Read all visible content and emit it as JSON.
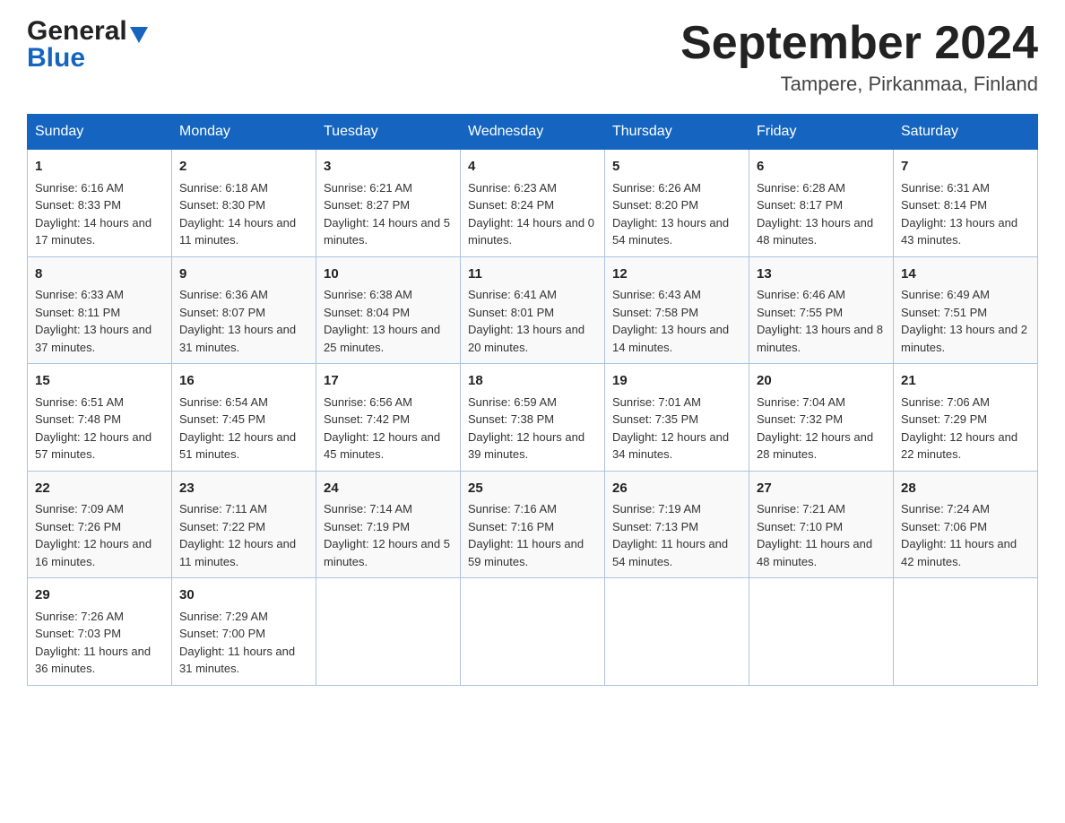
{
  "header": {
    "logo_general": "General",
    "logo_blue": "Blue",
    "month_title": "September 2024",
    "location": "Tampere, Pirkanmaa, Finland"
  },
  "weekdays": [
    "Sunday",
    "Monday",
    "Tuesday",
    "Wednesday",
    "Thursday",
    "Friday",
    "Saturday"
  ],
  "weeks": [
    [
      {
        "day": "1",
        "sunrise": "6:16 AM",
        "sunset": "8:33 PM",
        "daylight": "14 hours and 17 minutes."
      },
      {
        "day": "2",
        "sunrise": "6:18 AM",
        "sunset": "8:30 PM",
        "daylight": "14 hours and 11 minutes."
      },
      {
        "day": "3",
        "sunrise": "6:21 AM",
        "sunset": "8:27 PM",
        "daylight": "14 hours and 5 minutes."
      },
      {
        "day": "4",
        "sunrise": "6:23 AM",
        "sunset": "8:24 PM",
        "daylight": "14 hours and 0 minutes."
      },
      {
        "day": "5",
        "sunrise": "6:26 AM",
        "sunset": "8:20 PM",
        "daylight": "13 hours and 54 minutes."
      },
      {
        "day": "6",
        "sunrise": "6:28 AM",
        "sunset": "8:17 PM",
        "daylight": "13 hours and 48 minutes."
      },
      {
        "day": "7",
        "sunrise": "6:31 AM",
        "sunset": "8:14 PM",
        "daylight": "13 hours and 43 minutes."
      }
    ],
    [
      {
        "day": "8",
        "sunrise": "6:33 AM",
        "sunset": "8:11 PM",
        "daylight": "13 hours and 37 minutes."
      },
      {
        "day": "9",
        "sunrise": "6:36 AM",
        "sunset": "8:07 PM",
        "daylight": "13 hours and 31 minutes."
      },
      {
        "day": "10",
        "sunrise": "6:38 AM",
        "sunset": "8:04 PM",
        "daylight": "13 hours and 25 minutes."
      },
      {
        "day": "11",
        "sunrise": "6:41 AM",
        "sunset": "8:01 PM",
        "daylight": "13 hours and 20 minutes."
      },
      {
        "day": "12",
        "sunrise": "6:43 AM",
        "sunset": "7:58 PM",
        "daylight": "13 hours and 14 minutes."
      },
      {
        "day": "13",
        "sunrise": "6:46 AM",
        "sunset": "7:55 PM",
        "daylight": "13 hours and 8 minutes."
      },
      {
        "day": "14",
        "sunrise": "6:49 AM",
        "sunset": "7:51 PM",
        "daylight": "13 hours and 2 minutes."
      }
    ],
    [
      {
        "day": "15",
        "sunrise": "6:51 AM",
        "sunset": "7:48 PM",
        "daylight": "12 hours and 57 minutes."
      },
      {
        "day": "16",
        "sunrise": "6:54 AM",
        "sunset": "7:45 PM",
        "daylight": "12 hours and 51 minutes."
      },
      {
        "day": "17",
        "sunrise": "6:56 AM",
        "sunset": "7:42 PM",
        "daylight": "12 hours and 45 minutes."
      },
      {
        "day": "18",
        "sunrise": "6:59 AM",
        "sunset": "7:38 PM",
        "daylight": "12 hours and 39 minutes."
      },
      {
        "day": "19",
        "sunrise": "7:01 AM",
        "sunset": "7:35 PM",
        "daylight": "12 hours and 34 minutes."
      },
      {
        "day": "20",
        "sunrise": "7:04 AM",
        "sunset": "7:32 PM",
        "daylight": "12 hours and 28 minutes."
      },
      {
        "day": "21",
        "sunrise": "7:06 AM",
        "sunset": "7:29 PM",
        "daylight": "12 hours and 22 minutes."
      }
    ],
    [
      {
        "day": "22",
        "sunrise": "7:09 AM",
        "sunset": "7:26 PM",
        "daylight": "12 hours and 16 minutes."
      },
      {
        "day": "23",
        "sunrise": "7:11 AM",
        "sunset": "7:22 PM",
        "daylight": "12 hours and 11 minutes."
      },
      {
        "day": "24",
        "sunrise": "7:14 AM",
        "sunset": "7:19 PM",
        "daylight": "12 hours and 5 minutes."
      },
      {
        "day": "25",
        "sunrise": "7:16 AM",
        "sunset": "7:16 PM",
        "daylight": "11 hours and 59 minutes."
      },
      {
        "day": "26",
        "sunrise": "7:19 AM",
        "sunset": "7:13 PM",
        "daylight": "11 hours and 54 minutes."
      },
      {
        "day": "27",
        "sunrise": "7:21 AM",
        "sunset": "7:10 PM",
        "daylight": "11 hours and 48 minutes."
      },
      {
        "day": "28",
        "sunrise": "7:24 AM",
        "sunset": "7:06 PM",
        "daylight": "11 hours and 42 minutes."
      }
    ],
    [
      {
        "day": "29",
        "sunrise": "7:26 AM",
        "sunset": "7:03 PM",
        "daylight": "11 hours and 36 minutes."
      },
      {
        "day": "30",
        "sunrise": "7:29 AM",
        "sunset": "7:00 PM",
        "daylight": "11 hours and 31 minutes."
      },
      null,
      null,
      null,
      null,
      null
    ]
  ],
  "labels": {
    "sunrise": "Sunrise:",
    "sunset": "Sunset:",
    "daylight": "Daylight:"
  }
}
